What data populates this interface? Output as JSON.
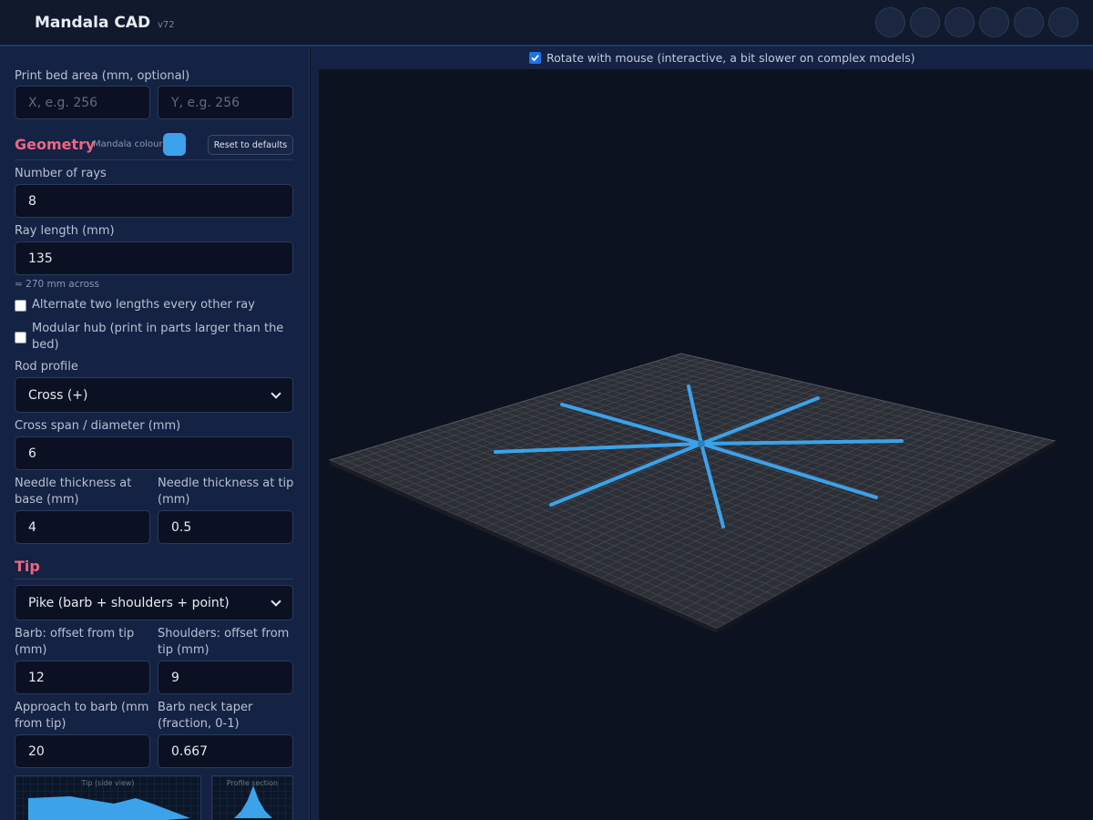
{
  "app": {
    "title": "Mandala CAD",
    "version": "v72"
  },
  "toolbar": {
    "buttons": [
      "btn-1",
      "btn-2",
      "btn-3",
      "btn-4",
      "btn-5",
      "btn-6"
    ]
  },
  "bed": {
    "label": "Print bed area (mm, optional)",
    "x_placeholder": "X, e.g. 256",
    "y_placeholder": "Y, e.g. 256"
  },
  "geometry": {
    "heading": "Geometry",
    "colour_label": "Mandala colour",
    "colour": "#3ca2ea",
    "reset_label": "Reset to defaults",
    "rays_label": "Number of rays",
    "rays_value": "8",
    "length_label": "Ray length (mm)",
    "length_value": "135",
    "across_hint": "≈ 270 mm across",
    "alternate_label": "Alternate two lengths every other ray",
    "alternate_checked": false,
    "modular_label": "Modular hub (print in parts larger than the bed)",
    "modular_checked": false,
    "profile_label": "Rod profile",
    "profile_value": "Cross (+)",
    "span_label": "Cross span / diameter (mm)",
    "span_value": "6",
    "needle_base_label": "Needle thickness at base (mm)",
    "needle_base_value": "4",
    "needle_tip_label": "Needle thickness at tip (mm)",
    "needle_tip_value": "0.5"
  },
  "tip": {
    "heading": "Tip",
    "style_value": "Pike (barb + shoulders + point)",
    "barb_offset_label": "Barb: offset from tip (mm)",
    "barb_offset_value": "12",
    "shoulders_offset_label": "Shoulders: offset from tip (mm)",
    "shoulders_offset_value": "9",
    "approach_label": "Approach to barb (mm from tip)",
    "approach_value": "20",
    "neck_taper_label": "Barb neck taper (fraction, 0-1)",
    "neck_taper_value": "0.667",
    "preview_side_label": "Tip (side view)",
    "preview_profile_label": "Profile section"
  },
  "viewer": {
    "rotate_label": "Rotate with mouse (interactive, a bit slower on complex models)",
    "rotate_checked": true
  },
  "colors": {
    "accent": "#f06480",
    "model": "#3ca2ea",
    "grid": "#4a4f58"
  }
}
